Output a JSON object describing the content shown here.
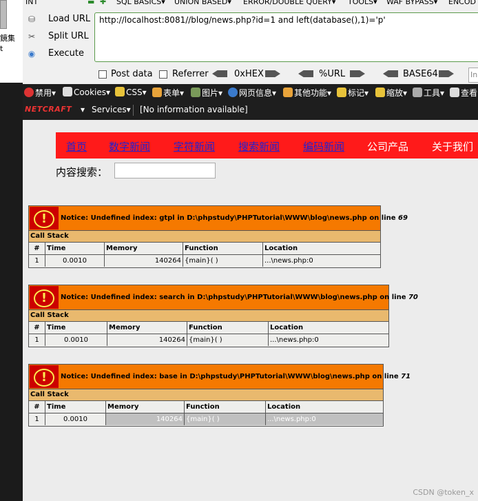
{
  "left_strip": {
    "label1": "鏡集",
    "label2": "t"
  },
  "hackbar": {
    "top_menu": [
      "INT",
      "SQL BASICS▾",
      "UNION BASED▾",
      "ERROR/DOUBLE QUERY▾",
      "TOOLS▾",
      "WAF BYPASS▾",
      "ENCOD"
    ],
    "actions": [
      "Load URL",
      "Split URL",
      "Execute"
    ],
    "url": "http://localhost:8081//blog/news.php?id=1 and left(database(),1)='p'",
    "options": {
      "post_data": "Post data",
      "referrer": "Referrer",
      "hex": "0xHEX",
      "url_enc": "%URL",
      "base64": "BASE64",
      "input_stub": "In"
    }
  },
  "toolbar1": [
    "禁用▾",
    "Cookies▾",
    "CSS▾",
    "表单▾",
    "图片▾",
    "网页信息▾",
    "其他功能▾",
    "标记▾",
    "缩放▾",
    "工具▾",
    "查看"
  ],
  "toolbar2": {
    "brand": "NETCRAFT",
    "dropdown": "▾",
    "services": "Services▾",
    "info": "[No information available]"
  },
  "nav": {
    "links": [
      "首页",
      "数字新闻",
      "字符新闻",
      "搜索新闻",
      "编码新闻"
    ],
    "plain": [
      "公司产品",
      "关于我们"
    ]
  },
  "search": {
    "label": "内容搜索：",
    "value": ""
  },
  "errors": [
    {
      "notice": "Notice: Undefined index: gtpl in D:\\phpstudy\\PHPTutorial\\WWW\\blog\\news.php on line",
      "line": "69",
      "call_stack": "Call Stack",
      "headers": [
        "#",
        "Time",
        "Memory",
        "Function",
        "Location"
      ],
      "row": [
        "1",
        "0.0010",
        "140264",
        "{main}( )",
        "...\\news.php:0"
      ]
    },
    {
      "notice": "Notice: Undefined index: search in D:\\phpstudy\\PHPTutorial\\WWW\\blog\\news.php on line",
      "line": "70",
      "call_stack": "Call Stack",
      "headers": [
        "#",
        "Time",
        "Memory",
        "Function",
        "Location"
      ],
      "row": [
        "1",
        "0.0010",
        "140264",
        "{main}( )",
        "...\\news.php:0"
      ]
    },
    {
      "notice": "Notice: Undefined index: base in D:\\phpstudy\\PHPTutorial\\WWW\\blog\\news.php on line",
      "line": "71",
      "call_stack": "Call Stack",
      "headers": [
        "#",
        "Time",
        "Memory",
        "Function",
        "Location"
      ],
      "row": [
        "1",
        "0.0010",
        "140264",
        "{main}( )",
        "...\\news.php:0"
      ]
    }
  ],
  "watermark": "CSDN @token_x"
}
